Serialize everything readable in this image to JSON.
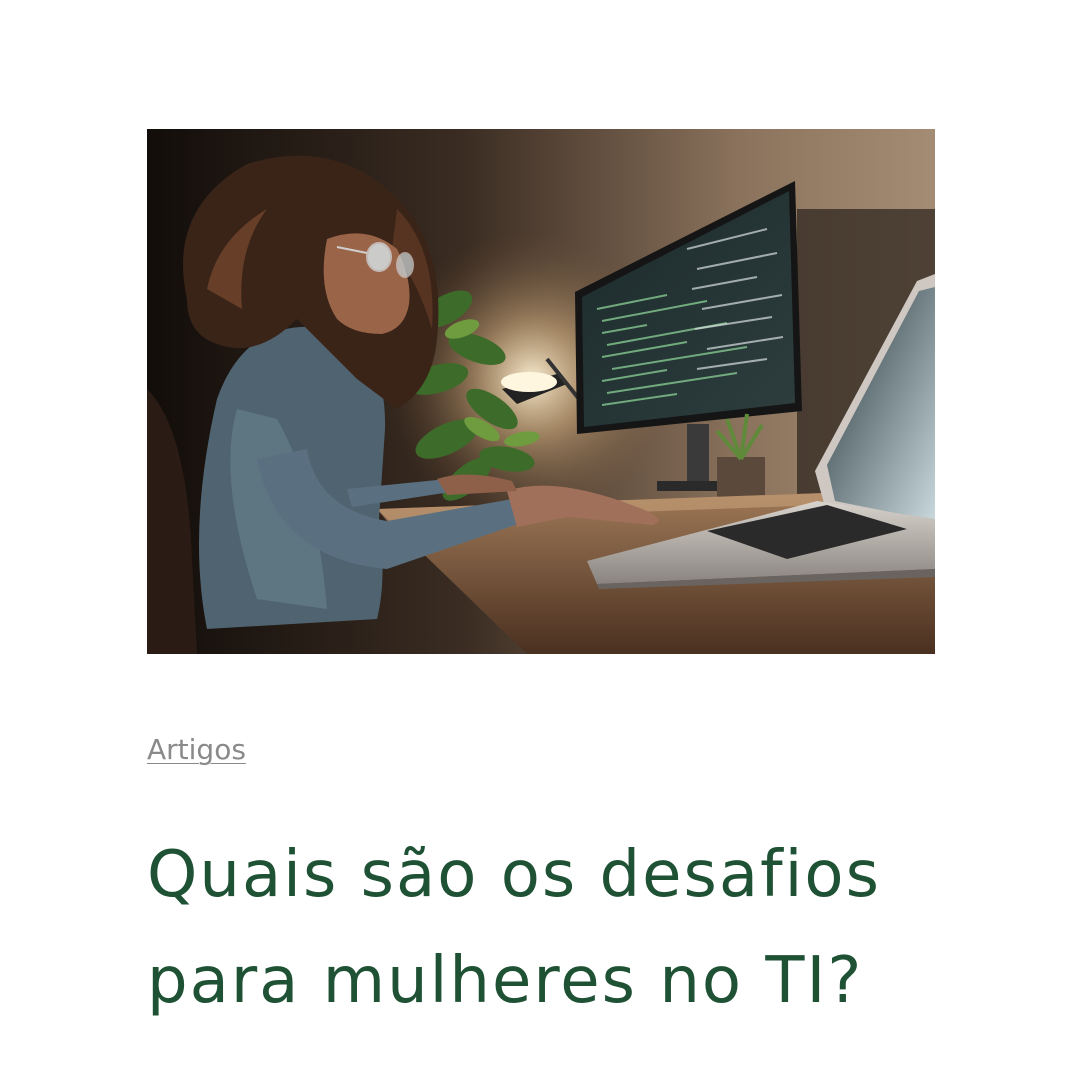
{
  "post": {
    "image_alt": "Mulher programando em frente a monitores com código",
    "category": "Artigos",
    "title": "Quais são os desafios para mulheres no TI?"
  },
  "colors": {
    "title": "#1f5234",
    "category": "#8a8a8a",
    "background": "#ffffff"
  }
}
